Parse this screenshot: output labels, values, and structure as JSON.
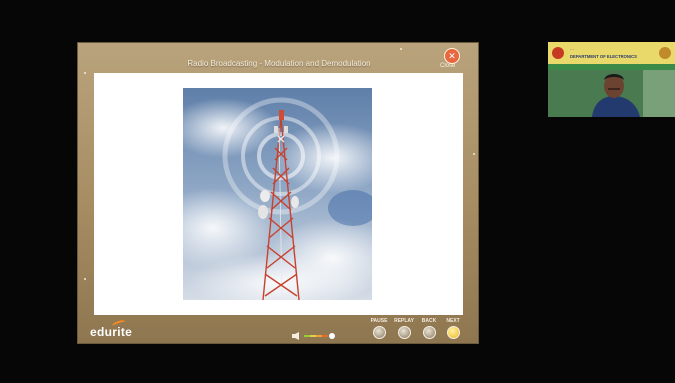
{
  "stage": {
    "title": "Radio Broadcasting - Modulation and Demodulation",
    "close_label": "Close",
    "close_glyph": "✕",
    "logo_text": "edurite"
  },
  "controls": {
    "pause": "PAUSE",
    "replay": "REPLAY",
    "back": "BACK",
    "next": "NEXT"
  },
  "webcam": {
    "banner_line1": "…",
    "banner_line2": "DEPARTMENT OF ELECTRONICS"
  },
  "colors": {
    "frame": "#a68c61",
    "close": "#e8673f",
    "sky": "#6f8db3",
    "tower_red": "#c7422f",
    "webcam_bg": "#2b6a3b"
  }
}
